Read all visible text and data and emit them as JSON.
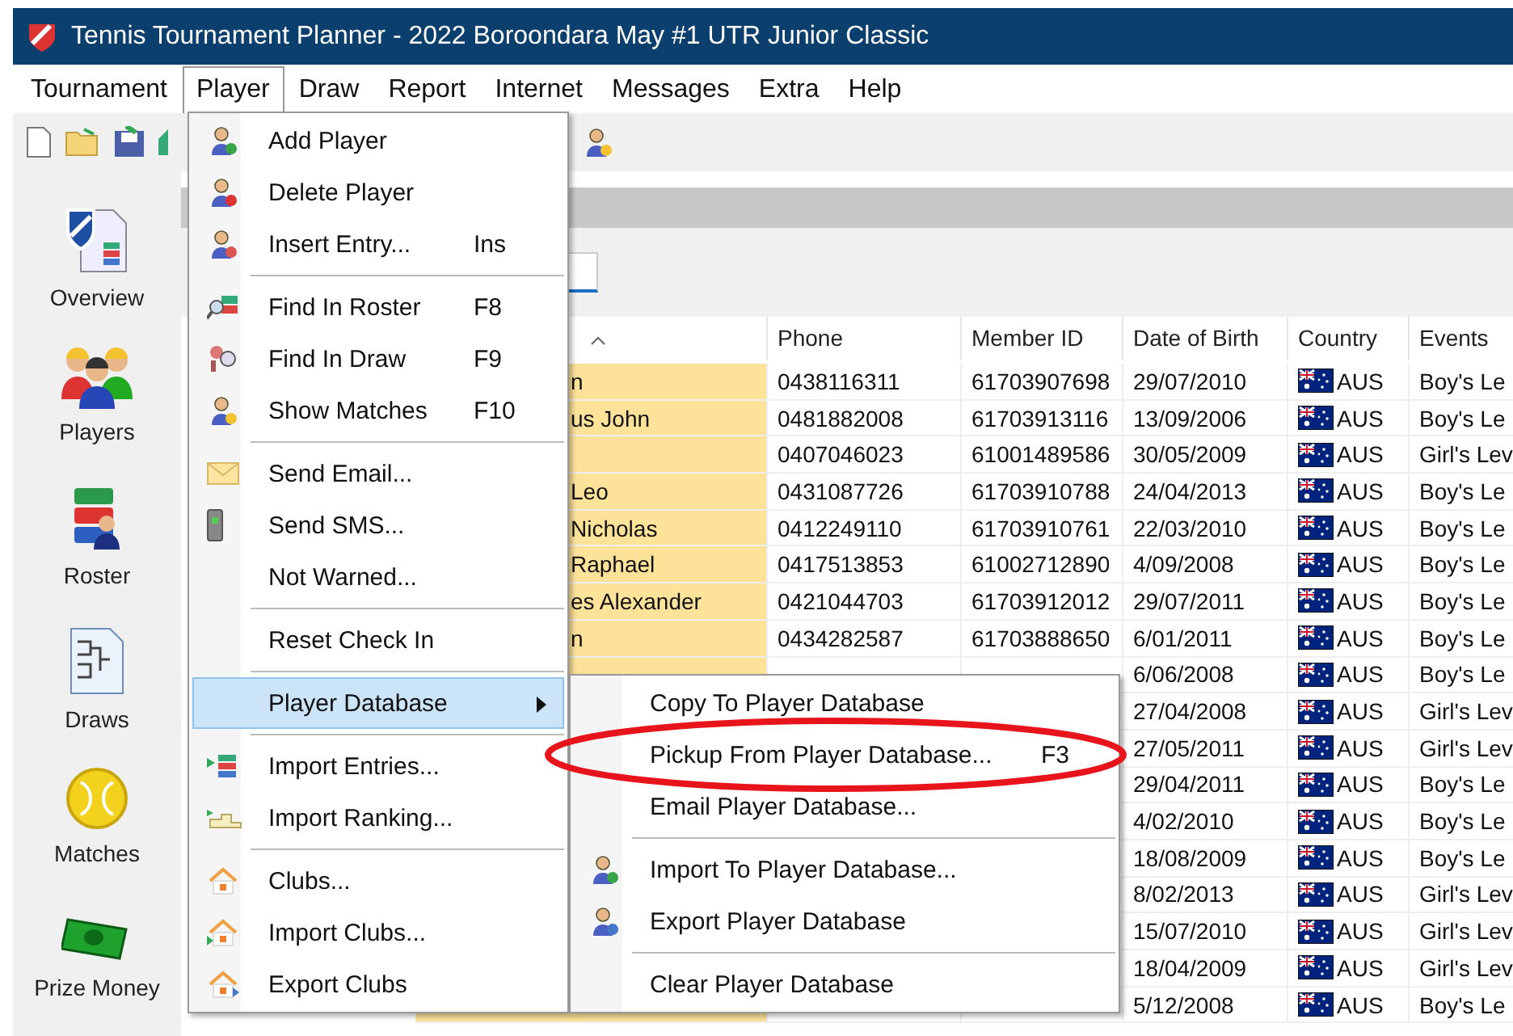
{
  "window": {
    "title": "Tennis Tournament Planner - 2022 Boroondara May #1 UTR Junior Classic"
  },
  "menu_bar": [
    {
      "label": "Tournament",
      "selected": false
    },
    {
      "label": "Player",
      "selected": true
    },
    {
      "label": "Draw",
      "selected": false
    },
    {
      "label": "Report",
      "selected": false
    },
    {
      "label": "Internet",
      "selected": false
    },
    {
      "label": "Messages",
      "selected": false
    },
    {
      "label": "Extra",
      "selected": false
    },
    {
      "label": "Help",
      "selected": false
    }
  ],
  "sidebar": {
    "items": [
      {
        "label": "Overview",
        "selected": false
      },
      {
        "label": "Players",
        "selected": false
      },
      {
        "label": "Roster",
        "selected": false
      },
      {
        "label": "Draws",
        "selected": false
      },
      {
        "label": "Matches",
        "selected": false
      },
      {
        "label": "Prize Money",
        "selected": false
      }
    ]
  },
  "table": {
    "name_column_sorted": true,
    "columns": [
      "Phone",
      "Member ID",
      "Date of Birth",
      "Country",
      "Events"
    ],
    "rows": [
      {
        "name": "n",
        "phone": "0438116311",
        "member_id": "61703907698",
        "dob": "29/07/2010",
        "country": "AUS",
        "events": "Boy's Le"
      },
      {
        "name": "us John",
        "phone": "0481882008",
        "member_id": "61703913116",
        "dob": "13/09/2006",
        "country": "AUS",
        "events": "Boy's Le"
      },
      {
        "phone": "0407046023",
        "member_id": "61001489586",
        "dob": "30/05/2009",
        "country": "AUS",
        "events": "Girl's Lev"
      },
      {
        "name": "Leo",
        "phone": "0431087726",
        "member_id": "61703910788",
        "dob": "24/04/2013",
        "country": "AUS",
        "events": "Boy's Le"
      },
      {
        "name": "Nicholas",
        "phone": "0412249110",
        "member_id": "61703910761",
        "dob": "22/03/2010",
        "country": "AUS",
        "events": "Boy's Le"
      },
      {
        "name": "Raphael",
        "phone": "0417513853",
        "member_id": "61002712890",
        "dob": "4/09/2008",
        "country": "AUS",
        "events": "Boy's Le"
      },
      {
        "name": "es Alexander",
        "phone": "0421044703",
        "member_id": "61703912012",
        "dob": "29/07/2011",
        "country": "AUS",
        "events": "Boy's Le"
      },
      {
        "name": "n",
        "phone": "0434282587",
        "member_id": "61703888650",
        "dob": "6/01/2011",
        "country": "AUS",
        "events": "Boy's Le"
      },
      {
        "dob": "6/06/2008",
        "country": "AUS",
        "events": "Boy's Le"
      },
      {
        "dob": "27/04/2008",
        "country": "AUS",
        "events": "Girl's Lev"
      },
      {
        "dob": "27/05/2011",
        "country": "AUS",
        "events": "Girl's Lev"
      },
      {
        "dob": "29/04/2011",
        "country": "AUS",
        "events": "Boy's Le"
      },
      {
        "dob": "4/02/2010",
        "country": "AUS",
        "events": "Boy's Le"
      },
      {
        "dob": "18/08/2009",
        "country": "AUS",
        "events": "Boy's Le"
      },
      {
        "dob": "8/02/2013",
        "country": "AUS",
        "events": "Girl's Lev"
      },
      {
        "dob": "15/07/2010",
        "country": "AUS",
        "events": "Girl's Lev"
      },
      {
        "dob": "18/04/2009",
        "country": "AUS",
        "events": "Girl's Lev"
      },
      {
        "dob": "5/12/2008",
        "country": "AUS",
        "events": "Boy's Le"
      }
    ]
  },
  "player_menu": [
    {
      "kind": "item",
      "label": "Add Player",
      "selected": false
    },
    {
      "kind": "item",
      "label": "Delete Player",
      "selected": false
    },
    {
      "kind": "item",
      "label": "Insert Entry...",
      "shortcut": "Ins",
      "selected": false
    },
    {
      "kind": "separator"
    },
    {
      "kind": "item",
      "label": "Find In Roster",
      "shortcut": "F8",
      "selected": false
    },
    {
      "kind": "item",
      "label": "Find In Draw",
      "shortcut": "F9",
      "selected": false
    },
    {
      "kind": "item",
      "label": "Show Matches",
      "shortcut": "F10",
      "selected": false
    },
    {
      "kind": "separator"
    },
    {
      "kind": "item",
      "label": "Send Email...",
      "selected": false
    },
    {
      "kind": "item",
      "label": "Send SMS...",
      "selected": false
    },
    {
      "kind": "item",
      "label": "Not Warned...",
      "selected": false
    },
    {
      "kind": "separator"
    },
    {
      "kind": "item",
      "label": "Reset Check In",
      "selected": false
    },
    {
      "kind": "separator"
    },
    {
      "kind": "item",
      "label": "Player Database",
      "submenu": true,
      "selected": true
    },
    {
      "kind": "separator"
    },
    {
      "kind": "item",
      "label": "Import Entries...",
      "selected": false
    },
    {
      "kind": "item",
      "label": "Import Ranking...",
      "selected": false
    },
    {
      "kind": "separator"
    },
    {
      "kind": "item",
      "label": "Clubs...",
      "selected": false
    },
    {
      "kind": "item",
      "label": "Import Clubs...",
      "selected": false
    },
    {
      "kind": "item",
      "label": "Export Clubs",
      "selected": false
    }
  ],
  "player_database_menu": [
    {
      "kind": "item",
      "label": "Copy To Player Database",
      "selected": false
    },
    {
      "kind": "item",
      "label": "Pickup From Player Database...",
      "shortcut": "F3",
      "selected": false
    },
    {
      "kind": "item",
      "label": "Email Player Database...",
      "selected": false
    },
    {
      "kind": "separator"
    },
    {
      "kind": "item",
      "label": "Import To Player Database...",
      "selected": false
    },
    {
      "kind": "item",
      "label": "Export Player Database",
      "selected": false
    },
    {
      "kind": "separator"
    },
    {
      "kind": "item",
      "label": "Clear Player Database",
      "selected": false
    }
  ],
  "annotation": {
    "kind": "ellipse",
    "color": "#e8141b"
  }
}
